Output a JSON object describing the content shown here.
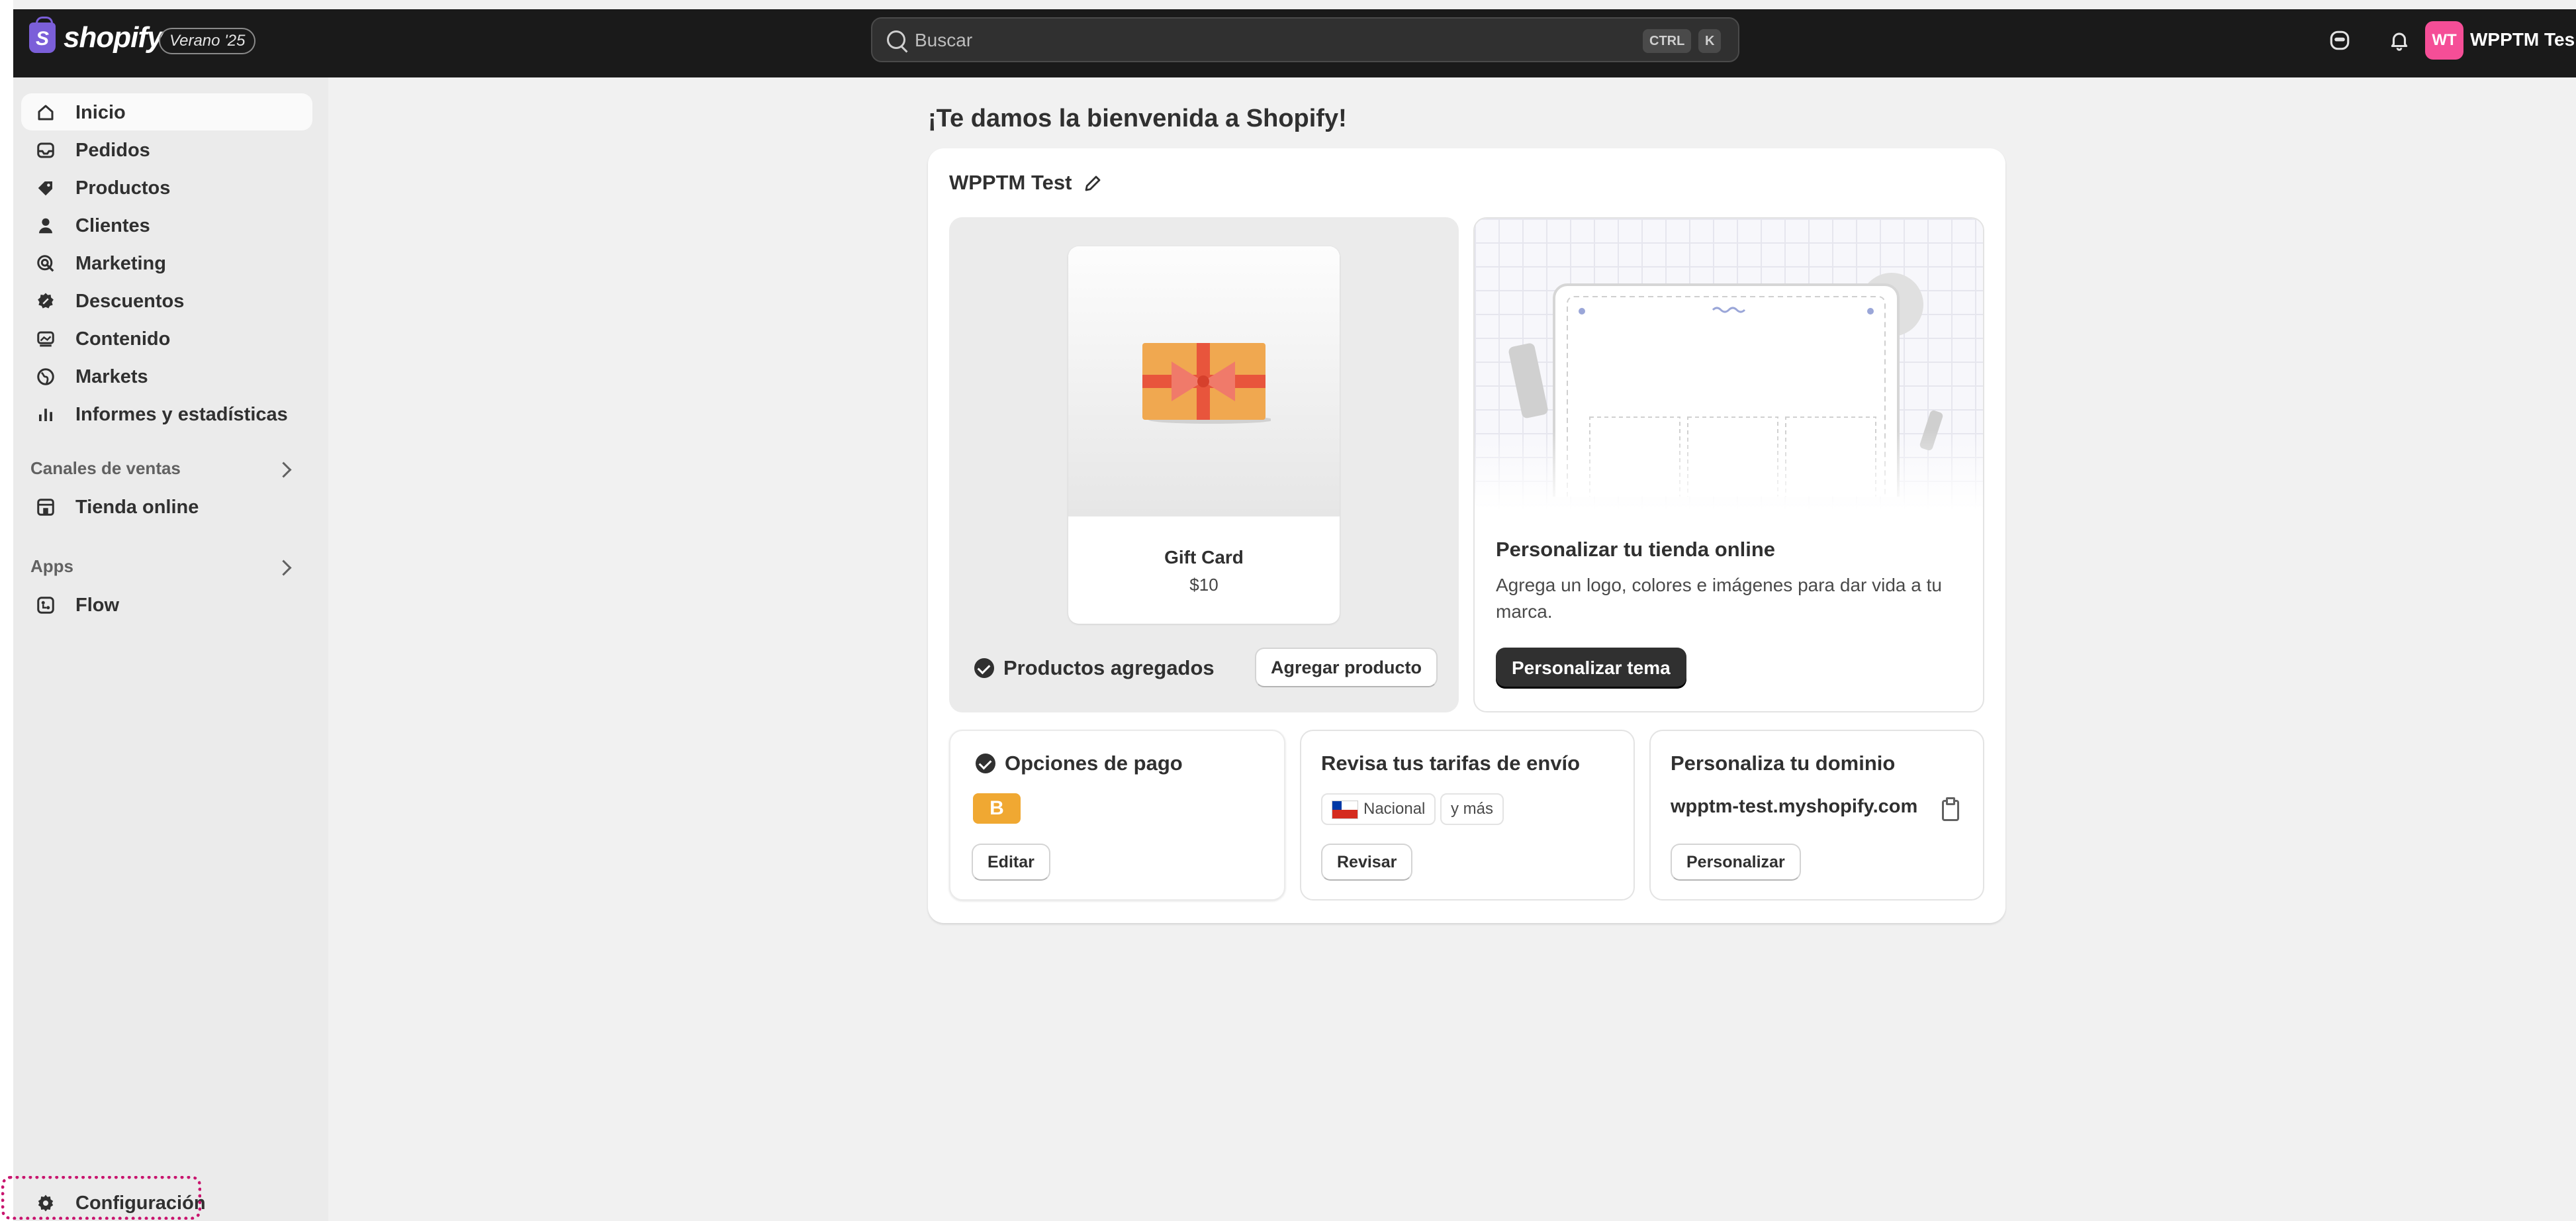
{
  "topbar": {
    "brand": "shopify",
    "logo_letter": "S",
    "edition": "Verano '25",
    "search": {
      "placeholder": "Buscar",
      "shortcut_1": "CTRL",
      "shortcut_2": "K"
    },
    "avatar_initials": "WT",
    "store_name": "WPPTM Tes"
  },
  "sidebar": {
    "items": [
      {
        "label": "Inicio",
        "icon": "home-icon"
      },
      {
        "label": "Pedidos",
        "icon": "inbox-icon"
      },
      {
        "label": "Productos",
        "icon": "tag-icon"
      },
      {
        "label": "Clientes",
        "icon": "person-icon"
      },
      {
        "label": "Marketing",
        "icon": "target-icon"
      },
      {
        "label": "Descuentos",
        "icon": "discount-icon"
      },
      {
        "label": "Contenido",
        "icon": "content-icon"
      },
      {
        "label": "Markets",
        "icon": "globe-icon"
      },
      {
        "label": "Informes y estadísticas",
        "icon": "chart-icon"
      }
    ],
    "sales_channels": {
      "title": "Canales de ventas",
      "items": [
        {
          "label": "Tienda online",
          "icon": "store-icon"
        }
      ]
    },
    "apps": {
      "title": "Apps",
      "items": [
        {
          "label": "Flow",
          "icon": "flow-icon"
        }
      ]
    },
    "settings": {
      "label": "Configuración",
      "icon": "gear-icon"
    }
  },
  "main": {
    "welcome": "¡Te damos la bienvenida a Shopify!",
    "store_title": "WPPTM Test",
    "products": {
      "gift_name": "Gift Card",
      "gift_price": "$10",
      "status": "Productos agregados",
      "add_button": "Agregar producto"
    },
    "theme": {
      "title": "Personalizar tu tienda online",
      "desc_line1": "Agrega un logo, colores e imágenes para dar vida a tu",
      "desc_line2": "marca.",
      "button": "Personalizar tema"
    },
    "payment": {
      "title": "Opciones de pago",
      "badge": "B",
      "button": "Editar"
    },
    "shipping": {
      "title": "Revisa tus tarifas de envío",
      "pill_1": "Nacional",
      "pill_2": "y más",
      "button": "Revisar"
    },
    "domain": {
      "title": "Personaliza tu dominio",
      "value": "wpptm-test.myshopify.com",
      "button": "Personalizar"
    }
  },
  "colors": {
    "topbar": "#1a1a1a",
    "avatar": "#f54e97",
    "accent_brand": "#7b5fd9",
    "badge": "#f0a832",
    "focus_ring": "#c8156e"
  }
}
